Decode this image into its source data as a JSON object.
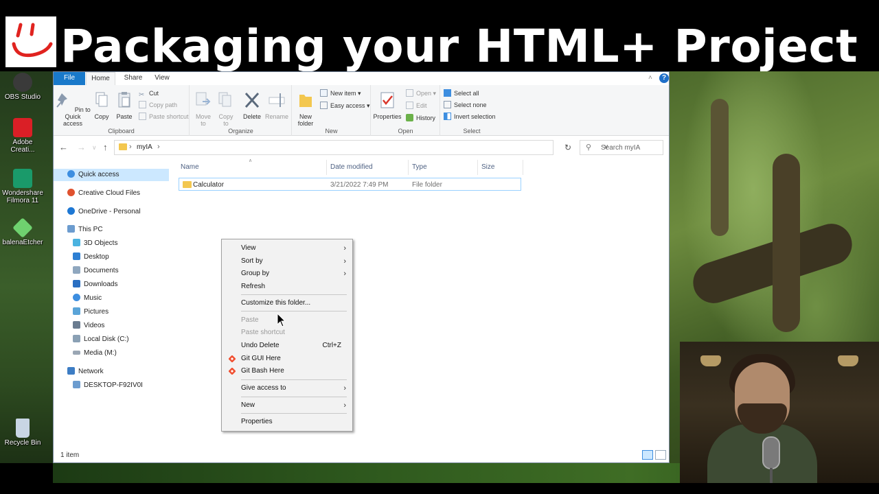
{
  "banner": {
    "title": "Packaging your HTML+ Project"
  },
  "desktop": {
    "icons": [
      {
        "label": "OBS Studio",
        "icon": "obs-icon",
        "color": "#3a3a3a"
      },
      {
        "label": "Adobe Creati...",
        "icon": "creative-cloud-icon",
        "color": "#da1f26"
      },
      {
        "label": "Wondershare Filmora 11",
        "icon": "filmora-icon",
        "color": "#1a9a6a"
      },
      {
        "label": "balenaEtcher",
        "icon": "etcher-icon",
        "color": "#6fd16f"
      },
      {
        "label": "Recycle Bin",
        "icon": "recycle-bin-icon",
        "color": "#c8d6e4"
      }
    ]
  },
  "ribbon": {
    "tabs": {
      "file": "File",
      "home": "Home",
      "share": "Share",
      "view": "View"
    },
    "clipboard": {
      "label": "Clipboard",
      "pin": "Pin to Quick access",
      "copy": "Copy",
      "paste": "Paste",
      "cut": "Cut",
      "copy_path": "Copy path",
      "paste_shortcut": "Paste shortcut"
    },
    "organize": {
      "label": "Organize",
      "move_to": "Move to",
      "copy_to": "Copy to",
      "delete": "Delete",
      "rename": "Rename"
    },
    "new": {
      "label": "New",
      "new_folder": "New folder",
      "new_item": "New item",
      "easy_access": "Easy access"
    },
    "open": {
      "label": "Open",
      "properties": "Properties",
      "open": "Open",
      "edit": "Edit",
      "history": "History"
    },
    "select": {
      "label": "Select",
      "select_all": "Select all",
      "select_none": "Select none",
      "invert": "Invert selection"
    }
  },
  "address": {
    "path": "myIA",
    "search_placeholder": "Search myIA"
  },
  "nav": {
    "quick_access": "Quick access",
    "creative_cloud": "Creative Cloud Files",
    "onedrive": "OneDrive - Personal",
    "this_pc": "This PC",
    "objects3d": "3D Objects",
    "desktop": "Desktop",
    "documents": "Documents",
    "downloads": "Downloads",
    "music": "Music",
    "pictures": "Pictures",
    "videos": "Videos",
    "local_disk": "Local Disk (C:)",
    "media": "Media (M:)",
    "network": "Network",
    "computer": "DESKTOP-F92IV0I"
  },
  "columns": {
    "name": "Name",
    "date": "Date modified",
    "type": "Type",
    "size": "Size"
  },
  "files": [
    {
      "name": "Calculator",
      "date": "3/21/2022 7:49 PM",
      "type": "File folder",
      "size": ""
    }
  ],
  "status": {
    "count": "1 item"
  },
  "context_menu": {
    "view": "View",
    "sort_by": "Sort by",
    "group_by": "Group by",
    "refresh": "Refresh",
    "customize": "Customize this folder...",
    "paste": "Paste",
    "paste_shortcut": "Paste shortcut",
    "undo_delete": "Undo Delete",
    "undo_shortcut": "Ctrl+Z",
    "git_gui": "Git GUI Here",
    "git_bash": "Git Bash Here",
    "give_access": "Give access to",
    "new": "New",
    "properties": "Properties"
  },
  "colors": {
    "accent": "#1979ca",
    "selection": "#cce8ff",
    "folder": "#f3c74f"
  }
}
